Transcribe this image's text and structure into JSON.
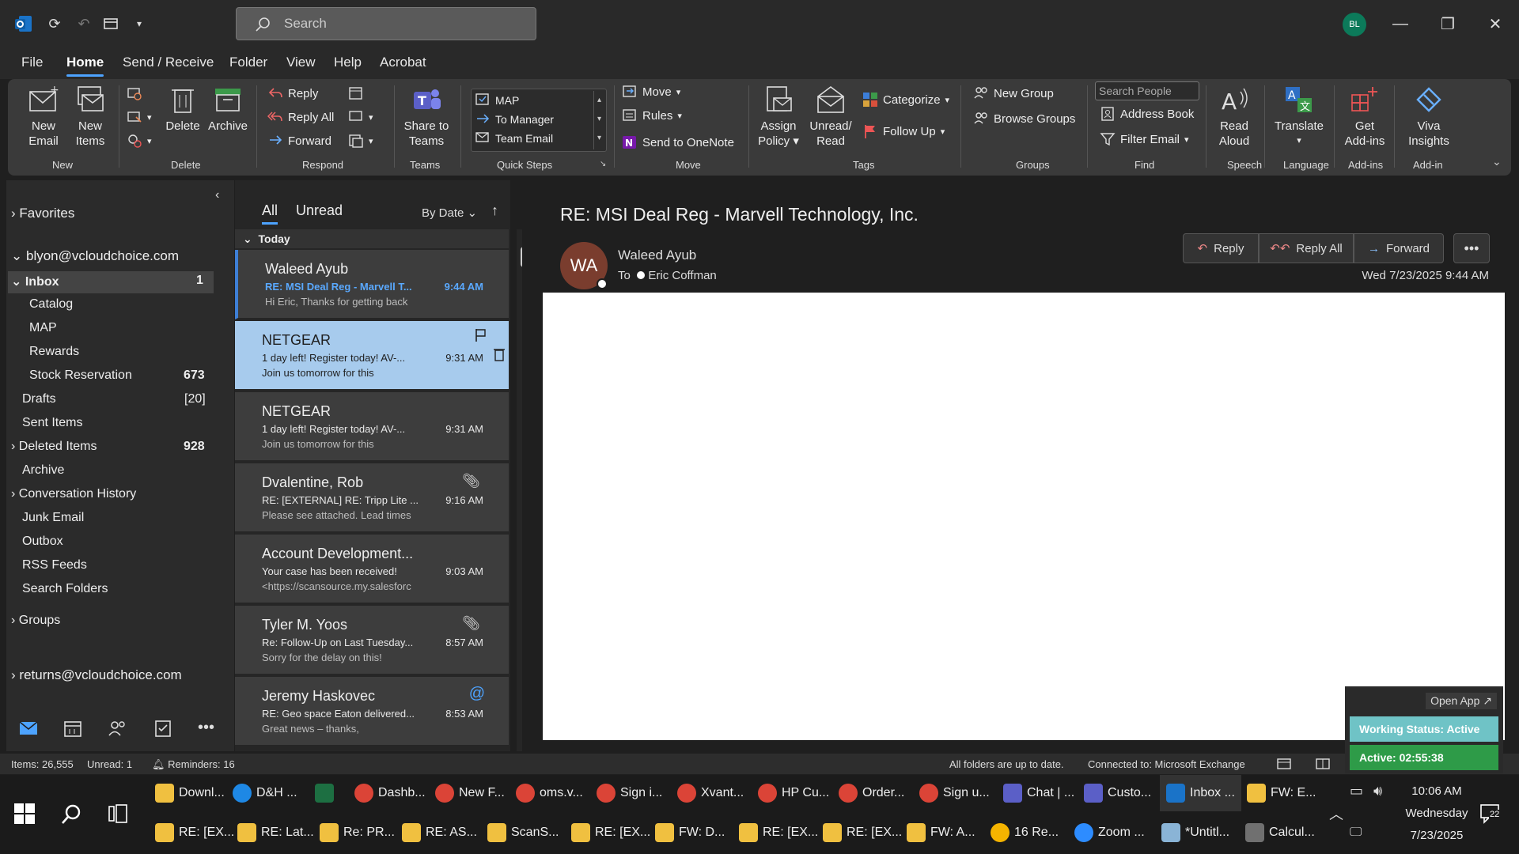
{
  "titlebar": {
    "search_placeholder": "Search",
    "avatar": "BL"
  },
  "menu": [
    "File",
    "Home",
    "Send / Receive",
    "Folder",
    "View",
    "Help",
    "Acrobat"
  ],
  "ribbon": {
    "new_email": [
      "New",
      "Email"
    ],
    "new_items": [
      "New",
      "Items"
    ],
    "delete": "Delete",
    "archive": "Archive",
    "reply": "Reply",
    "reply_all": "Reply All",
    "forward": "Forward",
    "share_teams": [
      "Share to",
      "Teams"
    ],
    "quick_steps": [
      "MAP",
      "To Manager",
      "Team Email"
    ],
    "move": "Move",
    "rules": "Rules",
    "onenote": "Send to OneNote",
    "assign_policy": [
      "Assign",
      "Policy"
    ],
    "unread_read": [
      "Unread/",
      "Read"
    ],
    "categorize": "Categorize",
    "follow_up": "Follow Up",
    "new_group": "New Group",
    "browse_groups": "Browse Groups",
    "search_people": "Search People",
    "address_book": "Address Book",
    "filter_email": "Filter Email",
    "read_aloud": [
      "Read",
      "Aloud"
    ],
    "translate": "Translate",
    "get_addins": [
      "Get",
      "Add-ins"
    ],
    "viva": [
      "Viva",
      "Insights"
    ],
    "groups": [
      "New",
      "Delete",
      "Respond",
      "Teams",
      "Quick Steps",
      "Move",
      "Tags",
      "Groups",
      "Find",
      "Speech",
      "Language",
      "Add-ins",
      "Add-in"
    ]
  },
  "nav": {
    "favorites": "Favorites",
    "account": "blyon@vcloudchoice.com",
    "folders": [
      {
        "name": "Inbox",
        "count": "1"
      },
      {
        "name": "Catalog",
        "count": ""
      },
      {
        "name": "MAP",
        "count": ""
      },
      {
        "name": "Rewards",
        "count": ""
      },
      {
        "name": "Stock Reservation",
        "count": "673"
      },
      {
        "name": "Drafts",
        "count": "[20]"
      },
      {
        "name": "Sent Items",
        "count": ""
      },
      {
        "name": "Deleted Items",
        "count": "928"
      },
      {
        "name": "Archive",
        "count": ""
      },
      {
        "name": "Conversation History",
        "count": ""
      },
      {
        "name": "Junk Email",
        "count": ""
      },
      {
        "name": "Outbox",
        "count": ""
      },
      {
        "name": "RSS Feeds",
        "count": ""
      },
      {
        "name": "Search Folders",
        "count": ""
      }
    ],
    "groups": "Groups",
    "account2": "returns@vcloudchoice.com"
  },
  "list": {
    "tab_all": "All",
    "tab_unread": "Unread",
    "sort": "By Date",
    "group_today": "Today",
    "messages": [
      {
        "sender": "Waleed Ayub",
        "subject": "RE: MSI Deal Reg - Marvell T...",
        "preview": "Hi Eric,  Thanks for getting back",
        "time": "9:44 AM"
      },
      {
        "sender": "NETGEAR",
        "subject": "1 day left! Register today! AV-...",
        "preview": "Join us tomorrow for this",
        "time": "9:31 AM"
      },
      {
        "sender": "NETGEAR",
        "subject": "1 day left! Register today! AV-...",
        "preview": "Join us tomorrow for this",
        "time": "9:31 AM"
      },
      {
        "sender": "Dvalentine, Rob",
        "subject": "RE: [EXTERNAL] RE: Tripp Lite ...",
        "preview": "Please see attached.  Lead times",
        "time": "9:16 AM"
      },
      {
        "sender": "Account Development...",
        "subject": "Your case has been received!",
        "preview": "<https://scansource.my.salesforc",
        "time": "9:03 AM"
      },
      {
        "sender": "Tyler M. Yoos",
        "subject": "Re: Follow-Up on Last Tuesday...",
        "preview": "Sorry for the delay on this!",
        "time": "8:57 AM"
      },
      {
        "sender": "Jeremy Haskovec",
        "subject": "RE: Geo space Eaton delivered...",
        "preview": "Great news – thanks,",
        "time": "8:53 AM"
      }
    ]
  },
  "reading": {
    "title": "RE: MSI Deal Reg - Marvell Technology, Inc.",
    "avatar": "WA",
    "sender": "Waleed Ayub",
    "to_label": "To",
    "to": "Eric Coffman",
    "date": "Wed 7/23/2025 9:44 AM",
    "reply": "Reply",
    "reply_all": "Reply All",
    "forward": "Forward"
  },
  "status": {
    "items": "Items: 26,555",
    "unread": "Unread: 1",
    "reminders": "Reminders: 16",
    "sync": "All folders are up to date.",
    "connected": "Connected to: Microsoft Exchange"
  },
  "popup": {
    "open_app": "Open App ↗",
    "working": "Working Status: Active",
    "active": "Active: 02:55:38"
  },
  "taskbar": {
    "row1": [
      "Downl...",
      "D&H ...",
      "",
      "Dashb...",
      "New F...",
      "oms.v...",
      "Sign i...",
      "Xvant...",
      "HP Cu...",
      "Order...",
      "Sign u...",
      "Chat | ...",
      "Custo...",
      "Inbox ...",
      "FW: E..."
    ],
    "row2": [
      "RE: [EX...",
      "RE: Lat...",
      "Re: PR...",
      "RE: AS...",
      "ScanS...",
      "RE: [EX...",
      "FW: D...",
      "RE: [EX...",
      "RE: [EX...",
      "FW: A...",
      "16 Re...",
      "Zoom ...",
      "*Untitl...",
      "Calcul..."
    ],
    "time": "10:06 AM",
    "day": "Wednesday",
    "date": "7/23/2025",
    "notif": "22"
  },
  "colors": {
    "accent": "#4da3ff",
    "selected": "#a7cbed",
    "popup_green": "#2e9b48"
  }
}
